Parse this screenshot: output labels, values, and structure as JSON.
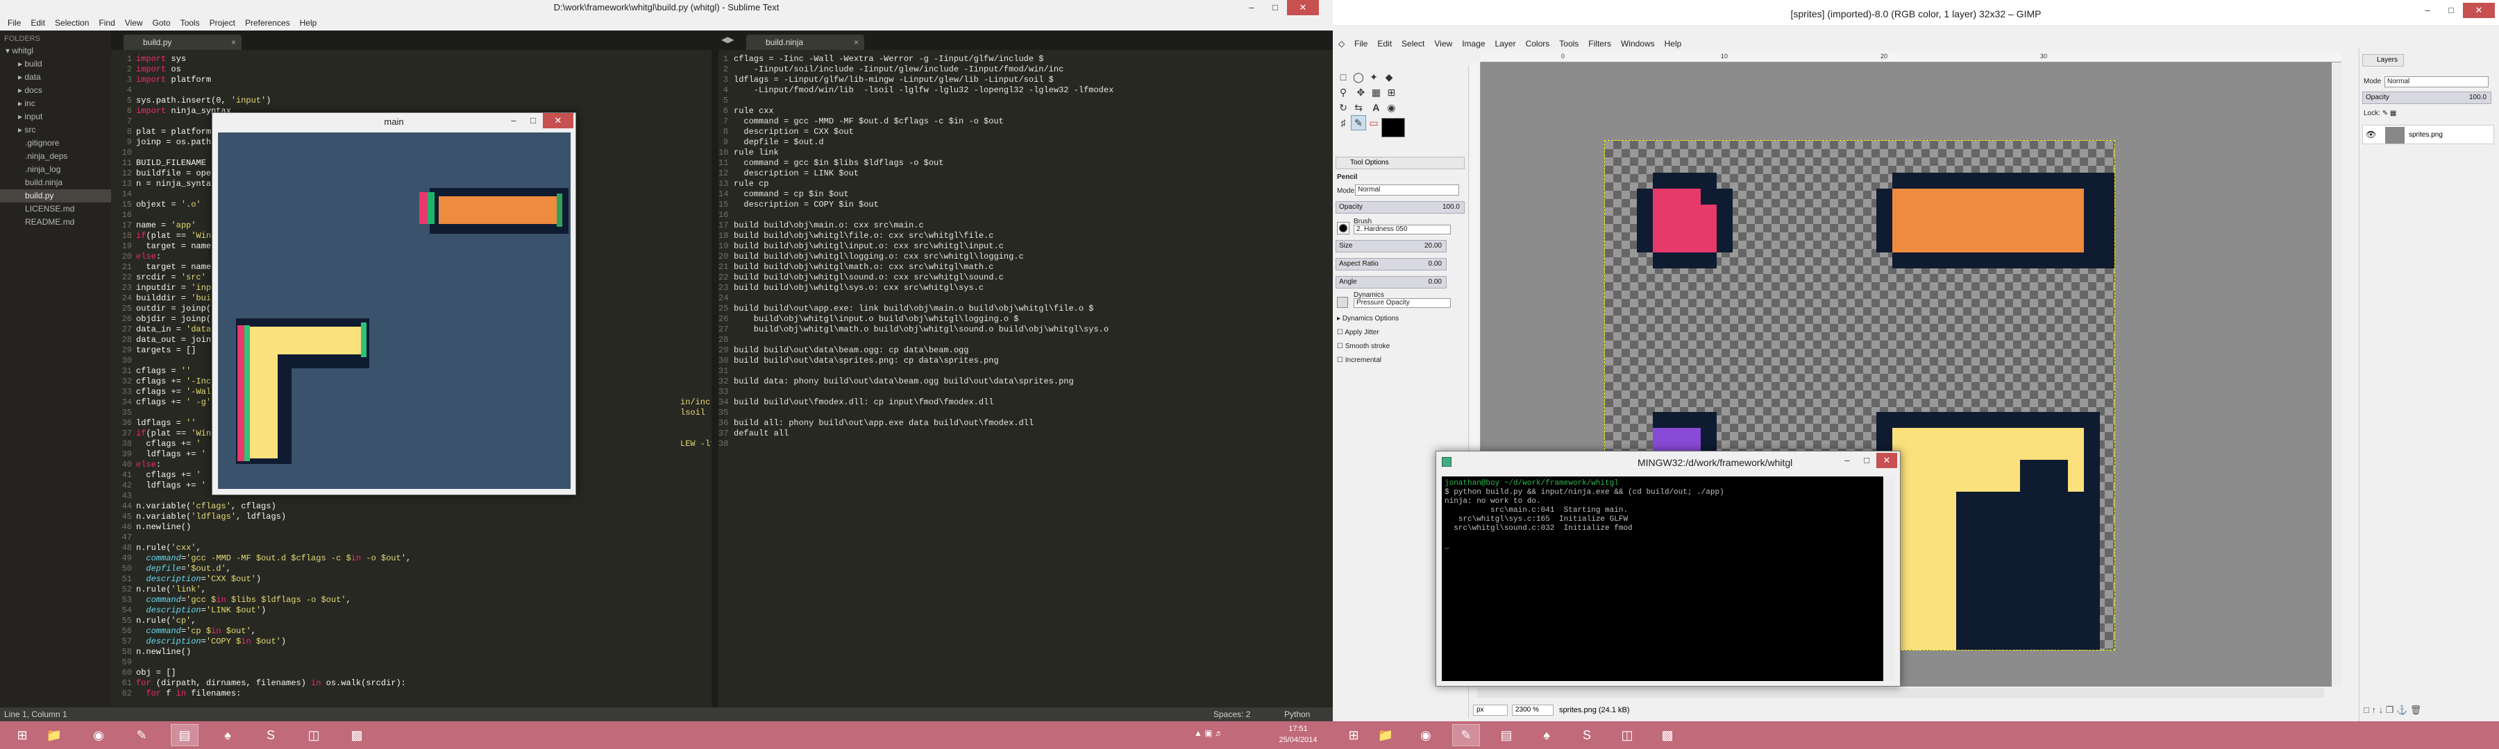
{
  "sublime": {
    "title": "D:\\work\\framework\\whitgl\\build.py (whitgl) - Sublime Text",
    "menu": [
      "File",
      "Edit",
      "Selection",
      "Find",
      "View",
      "Goto",
      "Tools",
      "Project",
      "Preferences",
      "Help"
    ],
    "sidebar_header": "FOLDERS",
    "tree": [
      {
        "label": "whitgl",
        "indent": 0,
        "type": "folder-open"
      },
      {
        "label": "build",
        "indent": 1,
        "type": "folder"
      },
      {
        "label": "data",
        "indent": 1,
        "type": "folder"
      },
      {
        "label": "docs",
        "indent": 1,
        "type": "folder"
      },
      {
        "label": "inc",
        "indent": 1,
        "type": "folder"
      },
      {
        "label": "input",
        "indent": 1,
        "type": "folder"
      },
      {
        "label": "src",
        "indent": 1,
        "type": "folder"
      },
      {
        "label": ".gitignore",
        "indent": 1,
        "type": "file"
      },
      {
        "label": ".ninja_deps",
        "indent": 1,
        "type": "file"
      },
      {
        "label": ".ninja_log",
        "indent": 1,
        "type": "file"
      },
      {
        "label": "build.ninja",
        "indent": 1,
        "type": "file"
      },
      {
        "label": "build.py",
        "indent": 1,
        "type": "file",
        "selected": true
      },
      {
        "label": "LICENSE.md",
        "indent": 1,
        "type": "file"
      },
      {
        "label": "README.md",
        "indent": 1,
        "type": "file"
      }
    ],
    "tab_left": "build.py",
    "tab_right": "build.ninja",
    "status_left": "Line 1, Column 1",
    "status_spaces": "Spaces: 2",
    "status_syntax": "Python",
    "left_code": [
      "import sys",
      "import os",
      "import platform",
      "",
      "sys.path.insert(0, 'input')",
      "import ninja_syntax",
      "",
      "plat = platform",
      "joinp = os.path",
      "",
      "BUILD_FILENAME",
      "buildfile = open",
      "n = ninja_syntax",
      "",
      "objext = '.o'",
      "",
      "name = 'app'",
      "if(plat == 'Wind",
      "  target = name",
      "else:",
      "  target = name",
      "srcdir = 'src'",
      "inputdir = 'inpu",
      "builddir = 'buil",
      "outdir = joinp(b",
      "objdir = joinp(b",
      "data_in = 'data",
      "data_out = joinp",
      "targets = []",
      "",
      "cflags = ''",
      "cflags += '-Inc",
      "cflags += '-Wal",
      "cflags += ' -g'",
      "",
      "ldflags = ''",
      "if(plat == 'Wind",
      "  cflags += '",
      "  ldflags += '",
      "else:",
      "  cflags += '",
      "  ldflags += '",
      "",
      "n.variable('cflags', cflags)",
      "n.variable('ldflags', ldflags)",
      "n.newline()",
      "",
      "n.rule('cxx',",
      "  command='gcc -MMD -MF $out.d $cflags -c $in -o $out',",
      "  depfile='$out.d',",
      "  description='CXX $out')",
      "n.rule('link',",
      "  command='gcc $in $libs $ldflags -o $out',",
      "  description='LINK $out')",
      "n.rule('cp',",
      "  command='cp $in $out',",
      "  description='COPY $in $out')",
      "n.newline()",
      "",
      "obj = []",
      "for (dirpath, dirnames, filenames) in os.walk(srcdir):",
      "  for f in filenames:"
    ],
    "left_overflow": [
      {
        "line": 34,
        "text": "in/inc'"
      },
      {
        "line": 35,
        "text": "lsoil -lglfw -lglu32 -lo"
      },
      {
        "line": 38,
        "text": "LEW -lfmodex-4.44.15 -lsoi"
      }
    ],
    "right_code": [
      "cflags = -Iinc -Wall -Wextra -Werror -g -Iinput/glfw/include $",
      "    -Iinput/soil/include -Iinput/glew/include -Iinput/fmod/win/inc",
      "ldflags = -Linput/glfw/lib-mingw -Linput/glew/lib -Linput/soil $",
      "    -Linput/fmod/win/lib  -lsoil -lglfw -lglu32 -lopengl32 -lglew32 -lfmodex",
      "",
      "rule cxx",
      "  command = gcc -MMD -MF $out.d $cflags -c $in -o $out",
      "  description = CXX $out",
      "  depfile = $out.d",
      "rule link",
      "  command = gcc $in $libs $ldflags -o $out",
      "  description = LINK $out",
      "rule cp",
      "  command = cp $in $out",
      "  description = COPY $in $out",
      "",
      "build build\\obj\\main.o: cxx src\\main.c",
      "build build\\obj\\whitgl\\file.o: cxx src\\whitgl\\file.c",
      "build build\\obj\\whitgl\\input.o: cxx src\\whitgl\\input.c",
      "build build\\obj\\whitgl\\logging.o: cxx src\\whitgl\\logging.c",
      "build build\\obj\\whitgl\\math.o: cxx src\\whitgl\\math.c",
      "build build\\obj\\whitgl\\sound.o: cxx src\\whitgl\\sound.c",
      "build build\\obj\\whitgl\\sys.o: cxx src\\whitgl\\sys.c",
      "",
      "build build\\out\\app.exe: link build\\obj\\main.o build\\obj\\whitgl\\file.o $",
      "    build\\obj\\whitgl\\input.o build\\obj\\whitgl\\logging.o $",
      "    build\\obj\\whitgl\\math.o build\\obj\\whitgl\\sound.o build\\obj\\whitgl\\sys.o",
      "",
      "build build\\out\\data\\beam.ogg: cp data\\beam.ogg",
      "build build\\out\\data\\sprites.png: cp data\\sprites.png",
      "",
      "build data: phony build\\out\\data\\beam.ogg build\\out\\data\\sprites.png",
      "",
      "build build\\out\\fmodex.dll: cp input\\fmod\\fmodex.dll",
      "",
      "build all: phony build\\out\\app.exe data build\\out\\fmodex.dll",
      "default all",
      ""
    ],
    "game_window_title": "main"
  },
  "gimp": {
    "title": "[sprites] (imported)-8.0 (RGB color, 1 layer) 32x32 – GIMP",
    "menu": [
      "File",
      "Edit",
      "Select",
      "View",
      "Image",
      "Layer",
      "Colors",
      "Tools",
      "Filters",
      "Windows",
      "Help"
    ],
    "tool_options_tab": "Tool Options",
    "tool_name": "Pencil",
    "mode_label": "Mode",
    "mode_value": "Normal",
    "opacity_label": "Opacity",
    "opacity_value": "100.0",
    "brush_label": "Brush",
    "brush_value": "2. Hardness 050",
    "size_label": "Size",
    "size_value": "20.00",
    "aspect_label": "Aspect Ratio",
    "aspect_value": "0.00",
    "angle_label": "Angle",
    "angle_value": "0.00",
    "dynamics_label": "Dynamics",
    "dynamics_value": "Pressure Opacity",
    "dynamics_options": "Dynamics Options",
    "apply_jitter": "Apply Jitter",
    "smooth_stroke": "Smooth stroke",
    "incremental": "Incremental",
    "ruler_marks": [
      "0",
      "10",
      "20",
      "30"
    ],
    "unit": "px",
    "zoom": "2300 %",
    "status_file": "sprites.png (24.1 kB)",
    "layers_tab": "Layers",
    "layers_mode_label": "Mode",
    "layers_mode_value": "Normal",
    "layers_opacity_label": "Opacity",
    "layers_opacity_value": "100.0",
    "lock_label": "Lock:",
    "layer_name": "sprites.png"
  },
  "mingw": {
    "title": "MINGW32:/d/work/framework/whitgl",
    "prompt": "jonathan@boy ~/d/work/framework/whitgl",
    "lines": [
      "$ python build.py && input/ninja.exe && (cd build/out; ./app)",
      "ninja: no work to do.",
      "          src\\main.c:041  Starting main.",
      "   src\\whitgl\\sys.c:165  Initialize GLFW",
      "  src\\whitgl\\sound.c:032  Initialize fmod",
      "",
      "_"
    ]
  },
  "taskbar": {
    "time": "17:51",
    "date": "25/04/2014"
  },
  "colors": {
    "pink": "#e8396b",
    "orange": "#ee8b3f",
    "yellow": "#fbe17c",
    "navy": "#0f1b31",
    "purple": "#8a4ad8",
    "taskbar": "#c06a7a"
  }
}
